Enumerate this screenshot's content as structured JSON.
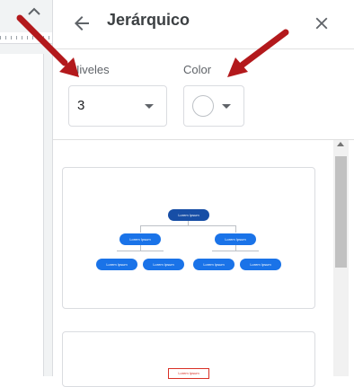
{
  "panel": {
    "title": "Jerárquico",
    "back_icon": "arrow-back-icon",
    "close_icon": "close-icon"
  },
  "options": {
    "levels_label": "Niveles",
    "levels_value": "3",
    "color_label": "Color",
    "color_value": "#ffffff"
  },
  "templates": [
    {
      "nodes": {
        "root": "Lorem Ipsum",
        "level2": [
          "Lorem Ipsum",
          "Lorem Ipsum"
        ],
        "level3": [
          "Lorem Ipsum",
          "Lorem Ipsum",
          "Lorem Ipsum",
          "Lorem Ipsum"
        ]
      }
    },
    {
      "nodes": {
        "root": "Lorem Ipsum"
      }
    }
  ],
  "colors": {
    "node_primary": "#1a73e8",
    "node_root": "#174ea6",
    "annotation_arrow": "#b3191c"
  }
}
